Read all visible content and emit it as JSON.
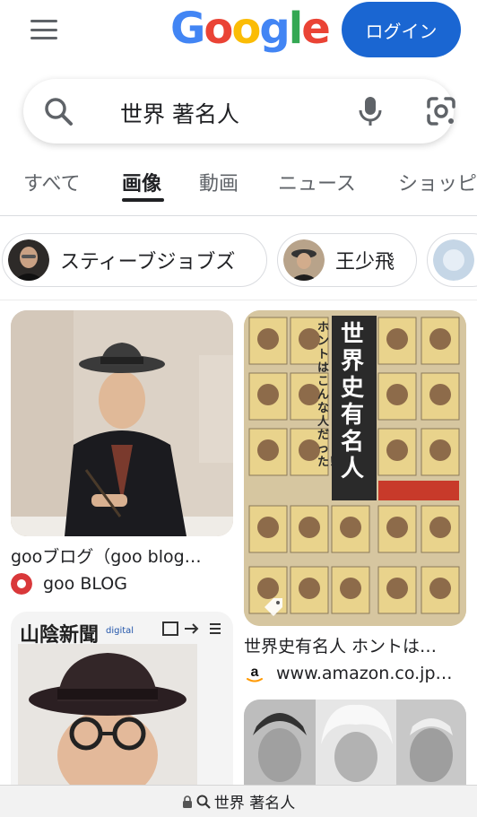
{
  "header": {
    "logo_text": "Google",
    "login_label": "ログイン"
  },
  "search": {
    "query": "世界 著名人"
  },
  "tabs": [
    {
      "label": "すべて"
    },
    {
      "label": "画像"
    },
    {
      "label": "動画"
    },
    {
      "label": "ニュース"
    },
    {
      "label": "ショッピ"
    }
  ],
  "chips": [
    {
      "label": "スティーブジョブズ"
    },
    {
      "label": "王少飛"
    }
  ],
  "results": [
    {
      "caption": "gooブログ（goo blog…",
      "source": "goo BLOG"
    },
    {
      "caption": "世界史有名人 ホントは…",
      "source": "www.amazon.co.jp…"
    },
    {
      "masthead": "山陰新聞",
      "masthead_tag": "digital"
    }
  ],
  "book_cover": {
    "title": "世界史有名人",
    "subtitle": "ホントはこんな人だった！"
  },
  "bottom_bar": {
    "url_text": "世界 著名人"
  },
  "colors": {
    "login_bg": "#1a66d2",
    "logo_blue": "#4285F4",
    "logo_red": "#EA4335",
    "logo_yellow": "#FBBC05",
    "logo_green": "#34A853"
  }
}
